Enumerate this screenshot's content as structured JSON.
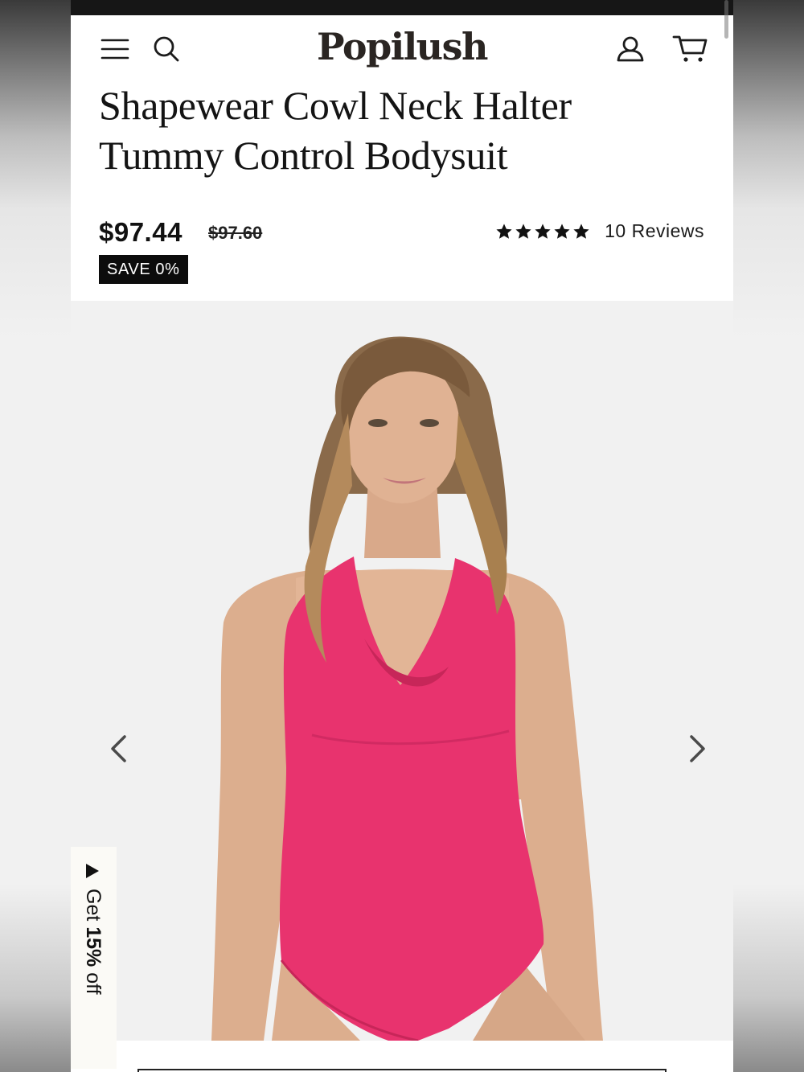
{
  "header": {
    "logo": "Popilush",
    "icons": [
      "menu-icon",
      "search-icon",
      "account-icon",
      "cart-icon"
    ]
  },
  "product": {
    "title_line1": "Shapewear Cowl Neck Halter",
    "title_line2": "Tummy Control Bodysuit",
    "price": "$97.44",
    "compare_price": "$97.60",
    "save_badge": "SAVE 0%",
    "rating": 5,
    "reviews_label": "10 Reviews"
  },
  "gallery": {
    "prev_icon": "chevron-left-icon",
    "next_icon": "chevron-right-icon",
    "garment_color": "#e8336e"
  },
  "promo": {
    "prefix": "Get ",
    "highlight": "15%",
    "suffix": " off"
  },
  "colors": {
    "accent_black": "#0c0c0c",
    "background": "#f1f1f1"
  }
}
